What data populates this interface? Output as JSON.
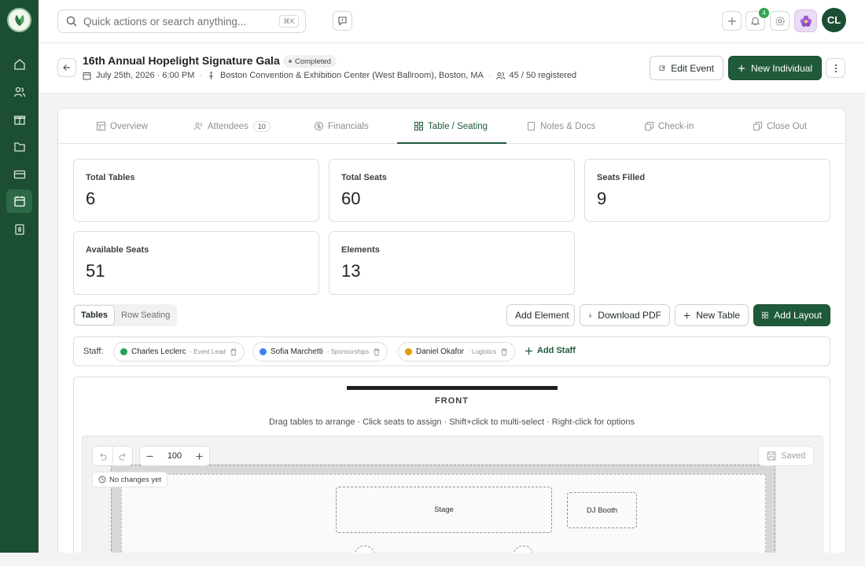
{
  "topbar": {
    "search_placeholder": "Quick actions or search anything...",
    "shortcut": "⌘K",
    "notification_count": "4",
    "user_initials": "CL"
  },
  "event": {
    "title": "16th Annual Hopelight Signature Gala",
    "status": "Completed",
    "date": "July 25th, 2026 · 6:00 PM",
    "venue": "Boston Convention & Exhibition Center (West Ballroom), Boston, MA",
    "registered": "45 / 50 registered",
    "edit_label": "Edit Event",
    "new_individual_label": "New Individual"
  },
  "tabs": [
    {
      "label": "Overview",
      "icon": "layout-icon"
    },
    {
      "label": "Attendees",
      "icon": "users-icon",
      "count": "10"
    },
    {
      "label": "Financials",
      "icon": "dollar-icon"
    },
    {
      "label": "Table / Seating",
      "icon": "grid-icon",
      "active": true
    },
    {
      "label": "Notes & Docs",
      "icon": "document-icon"
    },
    {
      "label": "Check-in",
      "icon": "copy-icon"
    },
    {
      "label": "Close Out",
      "icon": "copy-icon"
    }
  ],
  "stats": [
    {
      "label": "Total Tables",
      "value": "6"
    },
    {
      "label": "Total Seats",
      "value": "60"
    },
    {
      "label": "Seats Filled",
      "value": "9"
    },
    {
      "label": "Available Seats",
      "value": "51"
    },
    {
      "label": "Elements",
      "value": "13"
    }
  ],
  "view_toggle": {
    "tables": "Tables",
    "row_seating": "Row Seating"
  },
  "actions": {
    "add_element": "Add Element",
    "download_pdf": "Download PDF",
    "new_table": "New Table",
    "add_layout": "Add Layout"
  },
  "staff": {
    "label": "Staff:",
    "members": [
      {
        "name": "Charles Leclerc",
        "role": "· Event Lead",
        "color": "#22a35a"
      },
      {
        "name": "Sofia Marchetti",
        "role": "· Sponsorships",
        "color": "#3b82f6"
      },
      {
        "name": "Daniel Okafor",
        "role": "· Logistics",
        "color": "#e59a0b"
      }
    ],
    "add_label": "Add Staff"
  },
  "canvas": {
    "front_label": "FRONT",
    "hint": "Drag tables to arrange · Click seats to assign · Shift+click to multi-select · Right-click for options",
    "zoom": "100",
    "no_changes": "No changes yet",
    "saved": "Saved",
    "elements": [
      {
        "label": "Stage"
      },
      {
        "label": "DJ Booth"
      }
    ]
  },
  "colors": {
    "brand": "#1c4e33",
    "primary_button": "#1f5a3a"
  }
}
